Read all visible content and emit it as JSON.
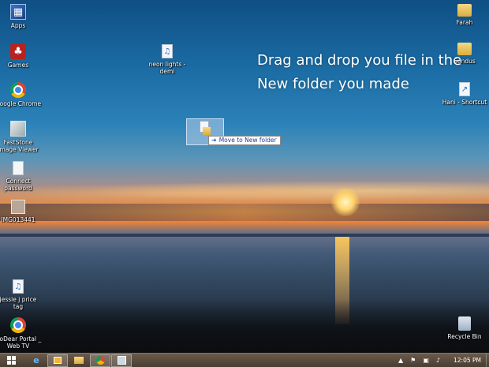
{
  "desktop": {
    "instruction": "Drag and drop you file in the New folder you made",
    "icons_left": [
      {
        "label": "Apps",
        "icon": "apps-icon"
      },
      {
        "label": "Games",
        "icon": "games-icon"
      },
      {
        "label": "Google Chrome",
        "icon": "chrome-icon"
      },
      {
        "label": "FastStone Image Viewer",
        "icon": "faststone-icon"
      },
      {
        "label": "Connect password",
        "icon": "document-icon"
      },
      {
        "label": "IMG013441",
        "icon": "image-file-icon"
      },
      {
        "label": "jessie j price tag",
        "icon": "music-file-icon"
      },
      {
        "label": "DoDear Portal _ Web TV",
        "icon": "chrome-icon"
      }
    ],
    "icon_middle": {
      "label": "neon lights -demi",
      "icon": "music-file-icon"
    },
    "icons_right": [
      {
        "label": "Farah",
        "icon": "folder-icon"
      },
      {
        "label": "Sundus",
        "icon": "folder-icon"
      },
      {
        "label": "Hani - Shortcut",
        "icon": "shortcut-icon"
      },
      {
        "label": "Recycle Bin",
        "icon": "recycle-bin-icon"
      }
    ],
    "drag": {
      "tooltip": "Move to New folder"
    }
  },
  "taskbar": {
    "buttons": [
      "start",
      "internet-explorer",
      "media-player",
      "file-explorer",
      "chrome",
      "faststone"
    ],
    "tray": {
      "time": "12:05 PM"
    }
  }
}
